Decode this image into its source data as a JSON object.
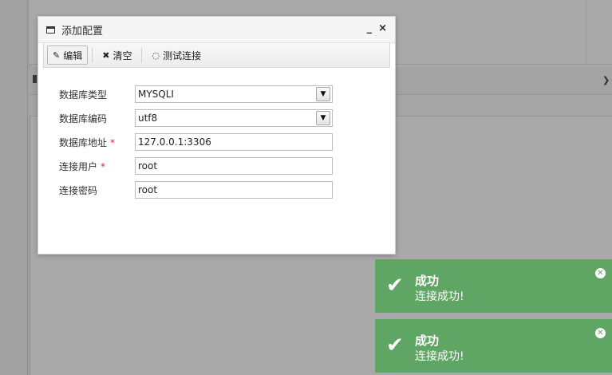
{
  "dialog": {
    "title": "添加配置",
    "minimize": "_",
    "close": "×",
    "toolbar": {
      "edit": "编辑",
      "clear": "清空",
      "test": "测试连接"
    },
    "form": {
      "db_type": {
        "label": "数据库类型",
        "value": "MYSQLI"
      },
      "db_encoding": {
        "label": "数据库编码",
        "value": "utf8"
      },
      "db_address": {
        "label": "数据库地址",
        "value": "127.0.0.1:3306",
        "required": "*"
      },
      "db_user": {
        "label": "连接用户",
        "value": "root",
        "required": "*"
      },
      "db_password": {
        "label": "连接密码",
        "value": "root"
      }
    }
  },
  "toasts": [
    {
      "title": "成功",
      "message": "连接成功!"
    },
    {
      "title": "成功",
      "message": "连接成功!"
    }
  ],
  "colors": {
    "toast_success": "#5fa664",
    "required": "#ee2233",
    "overlay": "#a9a9a9"
  }
}
